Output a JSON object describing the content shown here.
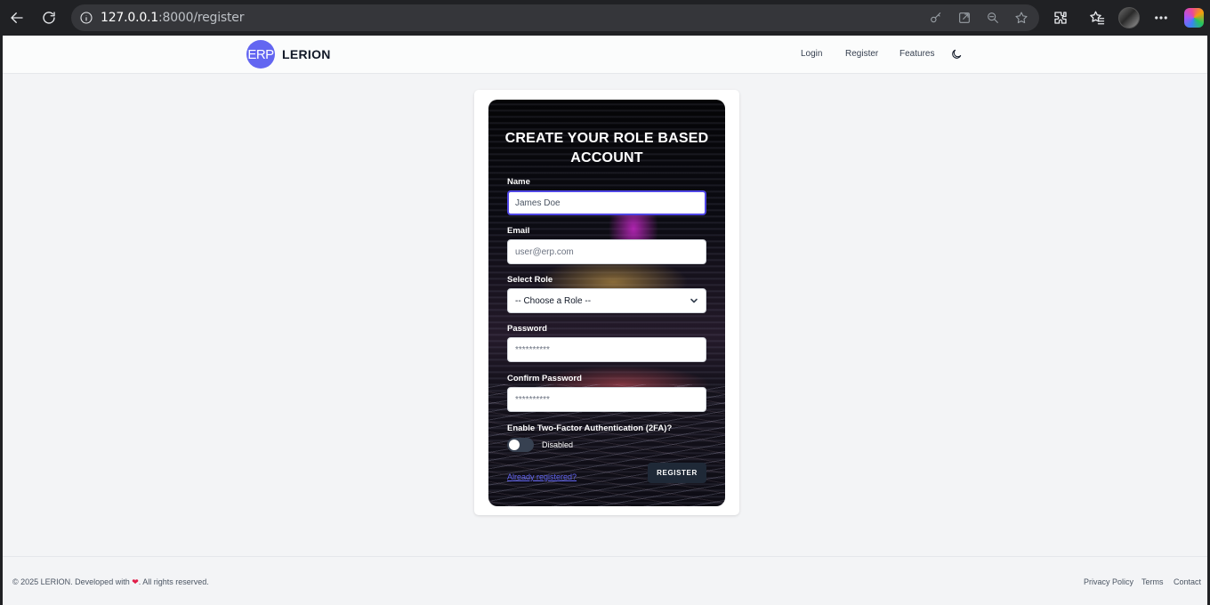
{
  "browser": {
    "url_host": "127.0.0.1",
    "url_rest": ":8000/register"
  },
  "navbar": {
    "logo_text": "ERP",
    "brand": "LERION",
    "links": [
      "Login",
      "Register",
      "Features"
    ]
  },
  "form": {
    "title": "CREATE YOUR ROLE BASED ACCOUNT",
    "name_label": "Name",
    "name_value": "James Doe",
    "email_label": "Email",
    "email_placeholder": "user@erp.com",
    "role_label": "Select Role",
    "role_selected": "-- Choose a Role --",
    "password_label": "Password",
    "password_placeholder": "**********",
    "confirm_label": "Confirm Password",
    "confirm_placeholder": "**********",
    "twofa_label": "Enable Two-Factor Authentication (2FA)?",
    "twofa_state": "Disabled",
    "already_link": "Already registered?",
    "submit_label": "REGISTER"
  },
  "footer": {
    "copyright_prefix": "© 2025 LERION. Developed with",
    "copyright_suffix": ". All rights reserved.",
    "links": [
      "Privacy Policy",
      "Terms",
      "Contact"
    ]
  },
  "colors": {
    "accent": "#6366f1",
    "button_dark": "#1f2937",
    "focus_border": "#4f46e5"
  }
}
